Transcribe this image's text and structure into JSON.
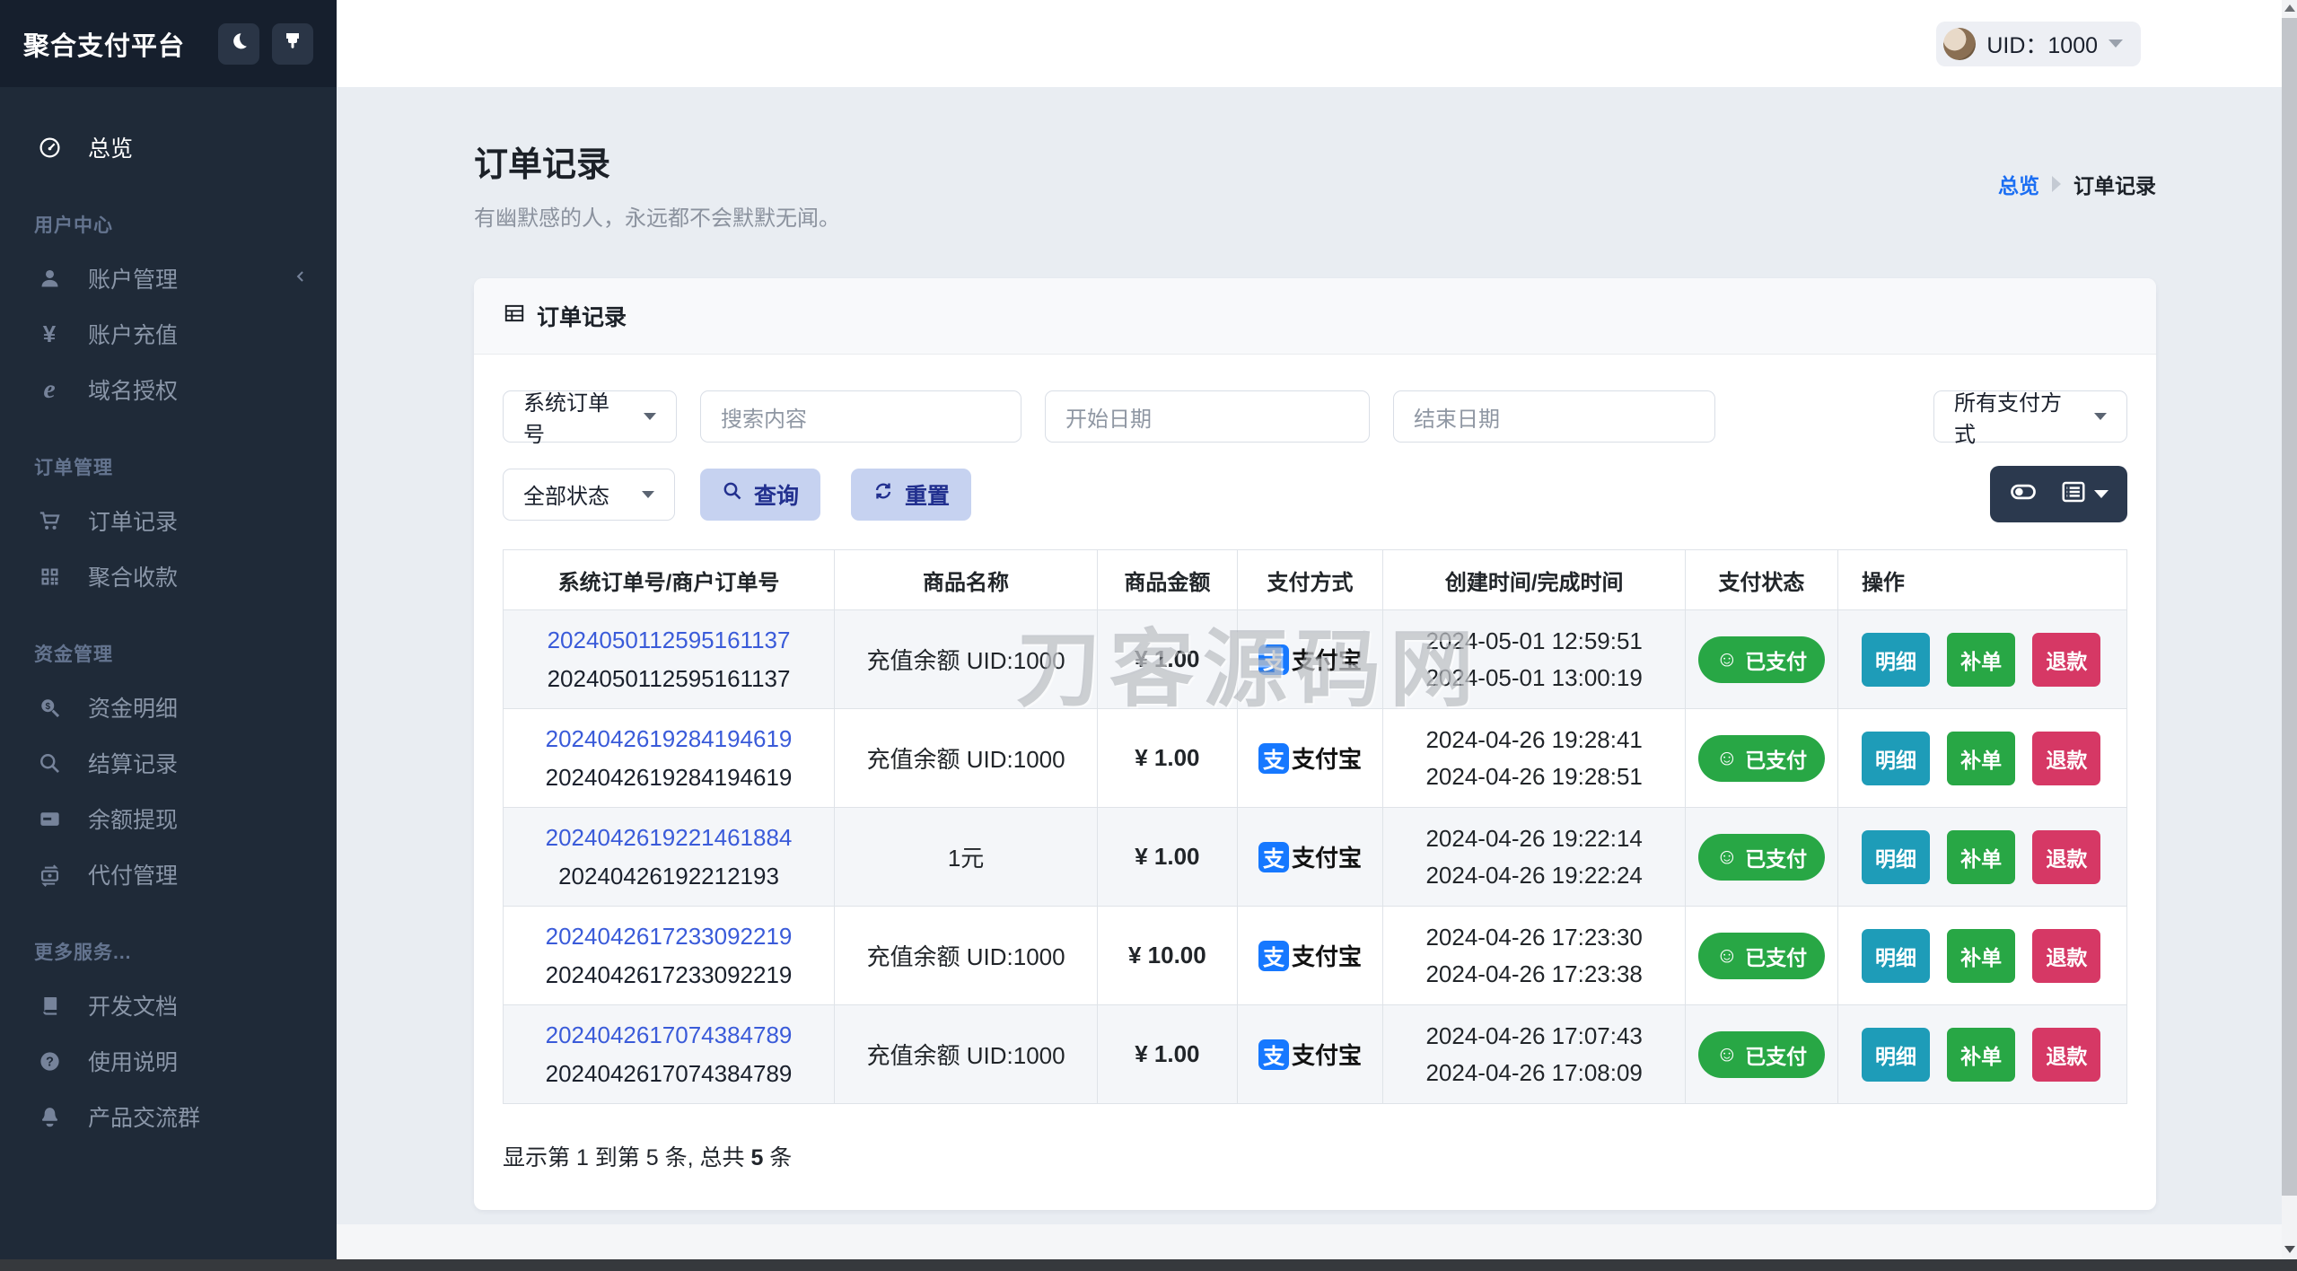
{
  "app": {
    "title": "聚合支付平台"
  },
  "topbar": {
    "uid": "UID：1000"
  },
  "icons": {
    "alipay_char": "支",
    "smile_char": "☺"
  },
  "sidebar": {
    "sections": [
      {
        "label": "",
        "items": [
          {
            "icon": "gauge-icon",
            "label": "总览",
            "active": true
          }
        ]
      },
      {
        "label": "用户中心",
        "items": [
          {
            "icon": "user-icon",
            "label": "账户管理",
            "chevron": true
          },
          {
            "icon": "yen-icon",
            "label": "账户充值"
          },
          {
            "icon": "explorer-icon",
            "label": "域名授权"
          }
        ]
      },
      {
        "label": "订单管理",
        "items": [
          {
            "icon": "cart-icon",
            "label": "订单记录"
          },
          {
            "icon": "qrcode-icon",
            "label": "聚合收款"
          }
        ]
      },
      {
        "label": "资金管理",
        "items": [
          {
            "icon": "search-dollar-icon",
            "label": "资金明细"
          },
          {
            "icon": "search-icon",
            "label": "结算记录"
          },
          {
            "icon": "credit-card-icon",
            "label": "余额提现"
          },
          {
            "icon": "money-transfer-icon",
            "label": "代付管理"
          }
        ]
      },
      {
        "label": "更多服务...",
        "items": [
          {
            "icon": "book-icon",
            "label": "开发文档"
          },
          {
            "icon": "question-icon",
            "label": "使用说明"
          },
          {
            "icon": "penguin-icon",
            "label": "产品交流群"
          }
        ]
      }
    ]
  },
  "page": {
    "title": "订单记录",
    "subtitle": "有幽默感的人，永远都不会默默无闻。",
    "breadcrumb": {
      "parent": "总览",
      "current": "订单记录"
    }
  },
  "card": {
    "title": "订单记录"
  },
  "filters": {
    "order_type": "系统订单号",
    "search_placeholder": "搜索内容",
    "start_date_placeholder": "开始日期",
    "end_date_placeholder": "结束日期",
    "pay_method": "所有支付方式",
    "status": "全部状态",
    "query_label": "查询",
    "reset_label": "重置"
  },
  "table": {
    "headers": [
      "系统订单号/商户订单号",
      "商品名称",
      "商品金额",
      "支付方式",
      "创建时间/完成时间",
      "支付状态",
      "操作"
    ],
    "action_labels": [
      "明细",
      "补单",
      "退款"
    ],
    "paid_label": "已支付",
    "rows": [
      {
        "sys_no": "2024050112595161137",
        "merchant_no": "2024050112595161137",
        "product": "充值余额 UID:1000",
        "amount": "¥ 1.00",
        "pay": "支付宝",
        "created": "2024-05-01 12:59:51",
        "completed": "2024-05-01 13:00:19",
        "status": "已支付"
      },
      {
        "sys_no": "2024042619284194619",
        "merchant_no": "2024042619284194619",
        "product": "充值余额 UID:1000",
        "amount": "¥ 1.00",
        "pay": "支付宝",
        "created": "2024-04-26 19:28:41",
        "completed": "2024-04-26 19:28:51",
        "status": "已支付"
      },
      {
        "sys_no": "2024042619221461884",
        "merchant_no": "20240426192212193",
        "product": "1元",
        "amount": "¥ 1.00",
        "pay": "支付宝",
        "created": "2024-04-26 19:22:14",
        "completed": "2024-04-26 19:22:24",
        "status": "已支付"
      },
      {
        "sys_no": "2024042617233092219",
        "merchant_no": "2024042617233092219",
        "product": "充值余额 UID:1000",
        "amount": "¥ 10.00",
        "pay": "支付宝",
        "created": "2024-04-26 17:23:30",
        "completed": "2024-04-26 17:23:38",
        "status": "已支付"
      },
      {
        "sys_no": "2024042617074384789",
        "merchant_no": "2024042617074384789",
        "product": "充值余额 UID:1000",
        "amount": "¥ 1.00",
        "pay": "支付宝",
        "created": "2024-04-26 17:07:43",
        "completed": "2024-04-26 17:08:09",
        "status": "已支付"
      }
    ]
  },
  "pagination": {
    "prefix": "显示第 1 到第 5 条, 总共 ",
    "count": "5",
    "suffix": " 条"
  },
  "watermark": "刀客源码网"
}
